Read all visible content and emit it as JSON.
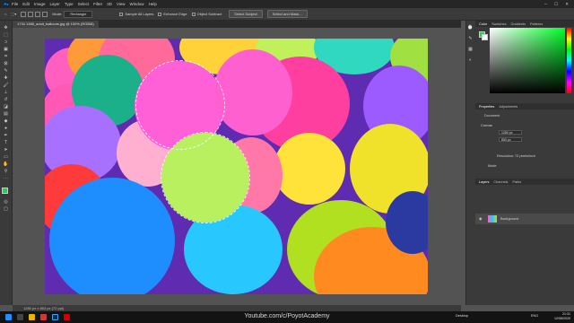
{
  "menubar": {
    "logo": "Ps",
    "items": [
      "File",
      "Edit",
      "Image",
      "Layer",
      "Type",
      "Select",
      "Filter",
      "3D",
      "View",
      "Window",
      "Help"
    ],
    "window_controls": [
      "─",
      "☐",
      "✕"
    ]
  },
  "options_bar": {
    "feather_label": "Mode:",
    "style_value": "Rectangle",
    "sample_all_layers_label": "Sample All Layers",
    "enhance_edge_label": "Enhance Edge",
    "object_subtract_label": "Object Subtract",
    "select_subject_label": "Select Subject",
    "select_and_mask_label": "Select and Mask..."
  },
  "document_tab": {
    "title": "1734 1388_adult_balloons.jpg @ 100% (RGB/8)"
  },
  "status_bar": {
    "text": "1280 px x 853 px (72 ppi)"
  },
  "panels": {
    "color_tabs": [
      "Color",
      "Swatches",
      "Gradients",
      "Patterns"
    ],
    "properties_tabs": [
      "Properties",
      "Adjustments"
    ],
    "properties_kind": "Document",
    "canvas_section": "Canvas",
    "width_value": "1280 px",
    "height_value": "853 px",
    "resolution_text": "Resolution: 72 pixels/inch",
    "mode_text": "Mode",
    "layers_tabs": [
      "Layers",
      "Channels",
      "Paths"
    ],
    "layer_name": "Background"
  },
  "taskbar": {
    "watermark": "Youtube.com/c/PoyotAcademy",
    "desktop_label": "Desktop",
    "lang": "ENG",
    "time": "21:31",
    "date": "12/08/2020"
  },
  "colors": {
    "foreground": "#22cc55",
    "background": "#ffffff",
    "accent": "#31a8ff"
  }
}
